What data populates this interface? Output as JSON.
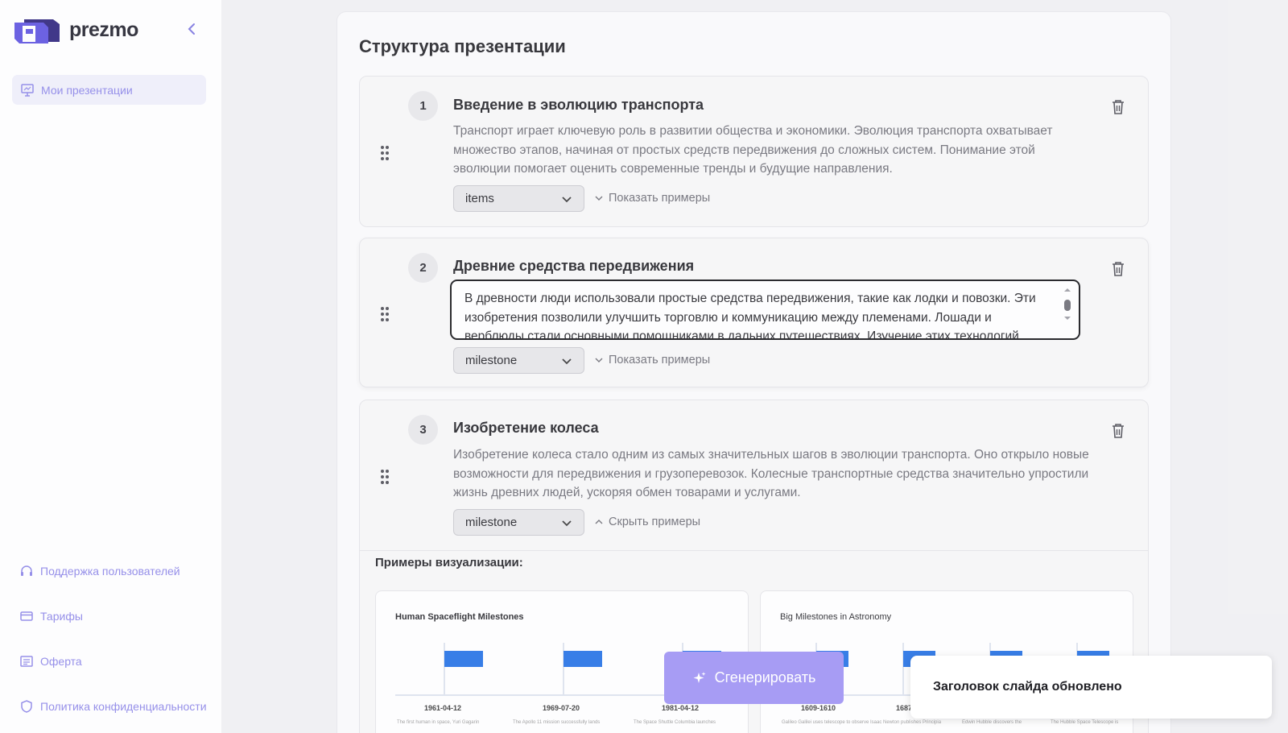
{
  "app": {
    "name": "prezmo"
  },
  "sidebar": {
    "active_item": "Мои презентации",
    "bottom_items": [
      {
        "label": "Поддержка пользователей",
        "icon": "headphones-icon"
      },
      {
        "label": "Тарифы",
        "icon": "card-icon"
      },
      {
        "label": "Оферта",
        "icon": "document-icon"
      },
      {
        "label": "Политика конфиденциальности",
        "icon": "shield-icon"
      }
    ]
  },
  "main": {
    "title": "Структура презентации",
    "slides": [
      {
        "number": "1",
        "title": "Введение в эволюцию транспорта",
        "description": "Транспорт играет ключевую роль в развитии общества и экономики. Эволюция транспорта охватывает множество этапов, начиная от простых средств передвижения до сложных систем. Понимание этой эволюции помогает оценить современные тренды и будущие направления.",
        "layout": "items",
        "examples_toggle": "Показать примеры"
      },
      {
        "number": "2",
        "title": "Древние средства передвижения",
        "description": "В древности люди использовали простые средства передвижения, такие как лодки и повозки. Эти изобретения позволили улучшить торговлю и коммуникацию между племенами. Лошади и верблюды стали основными помощниками в дальних путешествиях. Изучение этих технологий",
        "layout": "milestone",
        "examples_toggle": "Показать примеры"
      },
      {
        "number": "3",
        "title": "Изобретение колеса",
        "description": "Изобретение колеса стало одним из самых значительных шагов в эволюции транспорта. Оно открыло новые возможности для передвижения и грузоперевозок. Колесные транспортные средства значительно упростили жизнь древних людей, ускоряя обмен товарами и услугами.",
        "layout": "milestone",
        "examples_toggle": "Скрыть примеры"
      }
    ],
    "examples_heading": "Примеры визуализации:",
    "examples": [
      {
        "title": "Human Spaceflight Milestones",
        "dates": [
          "1961-04-12",
          "1969-07-20",
          "1981-04-12"
        ],
        "subs": [
          "The first human in space, Yuri Gagarin",
          "The Apollo 11 mission successfully lands",
          "The Space Shuttle Columbia launches"
        ]
      },
      {
        "title": "Big Milestones in Astronomy",
        "dates": [
          "1609-1610",
          "1687",
          "",
          ""
        ],
        "subs": [
          "Galileo Galilei uses telescope to observe",
          "Isaac Newton publishes Principia",
          "Edwin Hubble discovers the",
          "The Hubble Space Telescope is"
        ]
      }
    ]
  },
  "actions": {
    "generate_label": "Сгенерировать"
  },
  "toast": {
    "message": "Заголовок слайда обновлено"
  },
  "colors": {
    "accent": "#8a83e8",
    "button": "#a79cf4",
    "flag": "#1f6fe5"
  }
}
